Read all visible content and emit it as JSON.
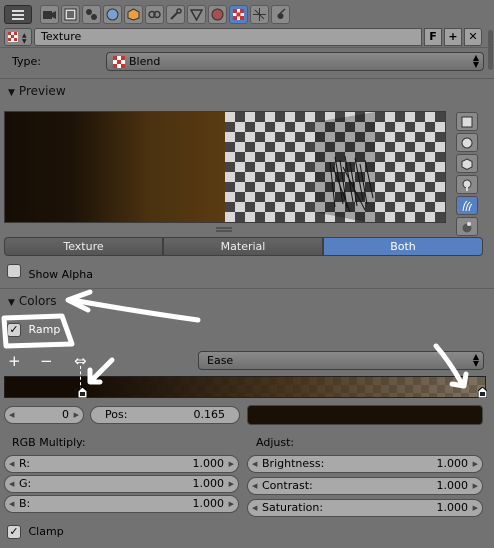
{
  "texture_block": {
    "name": "Texture",
    "fake_user": "F",
    "type_label": "Type:",
    "type_value": "Blend"
  },
  "preview": {
    "header": "Preview",
    "modes": [
      "Texture",
      "Material",
      "Both"
    ],
    "active_mode": "Both",
    "show_alpha_label": "Show Alpha"
  },
  "colors": {
    "header": "Colors",
    "ramp_label": "Ramp",
    "ramp_checked": true,
    "add_symbol": "+",
    "remove_symbol": "−",
    "flip_symbol": "⇔",
    "interpolation": "Ease",
    "active_index": "0",
    "pos_label": "Pos:",
    "pos_value": "0.165",
    "rgb_multiply_label": "RGB Multiply:",
    "r_label": "R:",
    "r_value": "1.000",
    "g_label": "G:",
    "g_value": "1.000",
    "b_label": "B:",
    "b_value": "1.000",
    "adjust_label": "Adjust:",
    "brightness_label": "Brightness:",
    "brightness_value": "1.000",
    "contrast_label": "Contrast:",
    "contrast_value": "1.000",
    "saturation_label": "Saturation:",
    "saturation_value": "1.000",
    "clamp_label": "Clamp",
    "clamp_checked": true
  },
  "colors_palette": {
    "accent": "#5680c2",
    "panel_bg": "#727272",
    "swatch": "#1b1005"
  }
}
